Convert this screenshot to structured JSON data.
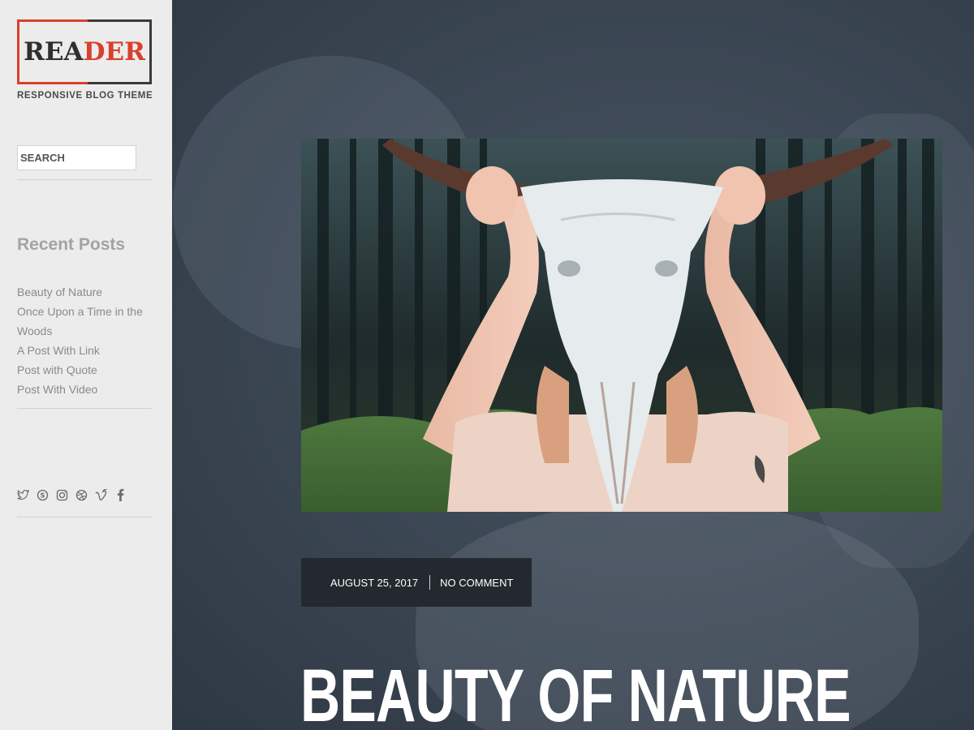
{
  "brand": {
    "logo_part1": "REA",
    "logo_part2": "DER",
    "tagline": "RESPONSIVE BLOG THEME",
    "accent_color": "#d9402c"
  },
  "search": {
    "placeholder": "SEARCH"
  },
  "recent_posts": {
    "title": "Recent Posts",
    "items": [
      "Beauty of Nature",
      "Once Upon a Time in the Woods",
      "A Post With Link",
      "Post with Quote",
      "Post With Video"
    ]
  },
  "social_icons": [
    "twitter-icon",
    "skype-icon",
    "instagram-icon",
    "dribbble-icon",
    "vimeo-icon",
    "facebook-icon"
  ],
  "post": {
    "date": "AUGUST 25, 2017",
    "comments": "NO COMMENT",
    "title": "BEAUTY OF NATURE"
  }
}
